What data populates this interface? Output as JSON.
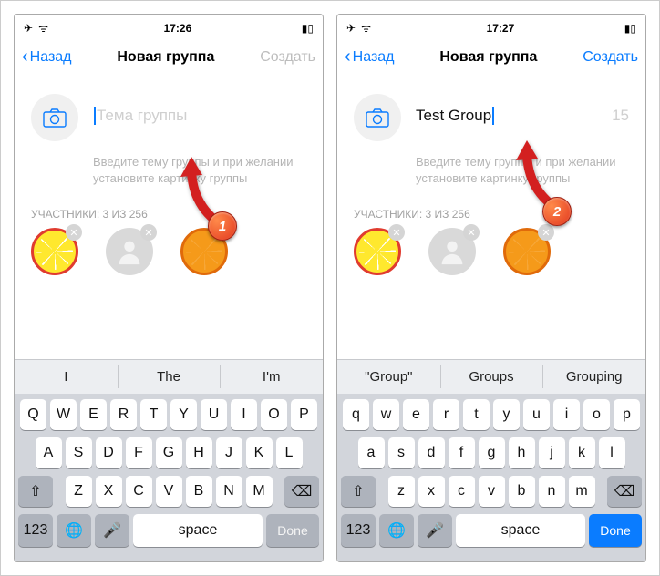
{
  "left": {
    "status": {
      "time": "17:26"
    },
    "nav": {
      "back": "Назад",
      "title": "Новая группа",
      "action": "Создать"
    },
    "form": {
      "placeholder": "Тема группы",
      "value": "",
      "helper": "Введите тему группы и при желании установите картинку группы"
    },
    "participants_label": "УЧАСТНИКИ: 3 ИЗ 256",
    "suggestions": [
      "I",
      "The",
      "I'm"
    ],
    "keys_r1": [
      "Q",
      "W",
      "E",
      "R",
      "T",
      "Y",
      "U",
      "I",
      "O",
      "P"
    ],
    "keys_r2": [
      "A",
      "S",
      "D",
      "F",
      "G",
      "H",
      "J",
      "K",
      "L"
    ],
    "keys_r3": [
      "Z",
      "X",
      "C",
      "V",
      "B",
      "N",
      "M"
    ],
    "bottom": {
      "num": "123",
      "space": "space",
      "done": "Done"
    },
    "step": "1"
  },
  "right": {
    "status": {
      "time": "17:27"
    },
    "nav": {
      "back": "Назад",
      "title": "Новая группа",
      "action": "Создать"
    },
    "form": {
      "placeholder": "",
      "value": "Test Group",
      "counter": "15",
      "helper": "Введите тему группы и при желании установите картинку группы"
    },
    "participants_label": "УЧАСТНИКИ: 3 ИЗ 256",
    "suggestions": [
      "\"Group\"",
      "Groups",
      "Grouping"
    ],
    "keys_r1": [
      "q",
      "w",
      "e",
      "r",
      "t",
      "y",
      "u",
      "i",
      "o",
      "p"
    ],
    "keys_r2": [
      "a",
      "s",
      "d",
      "f",
      "g",
      "h",
      "j",
      "k",
      "l"
    ],
    "keys_r3": [
      "z",
      "x",
      "c",
      "v",
      "b",
      "n",
      "m"
    ],
    "bottom": {
      "num": "123",
      "space": "space",
      "done": "Done"
    },
    "step": "2"
  }
}
